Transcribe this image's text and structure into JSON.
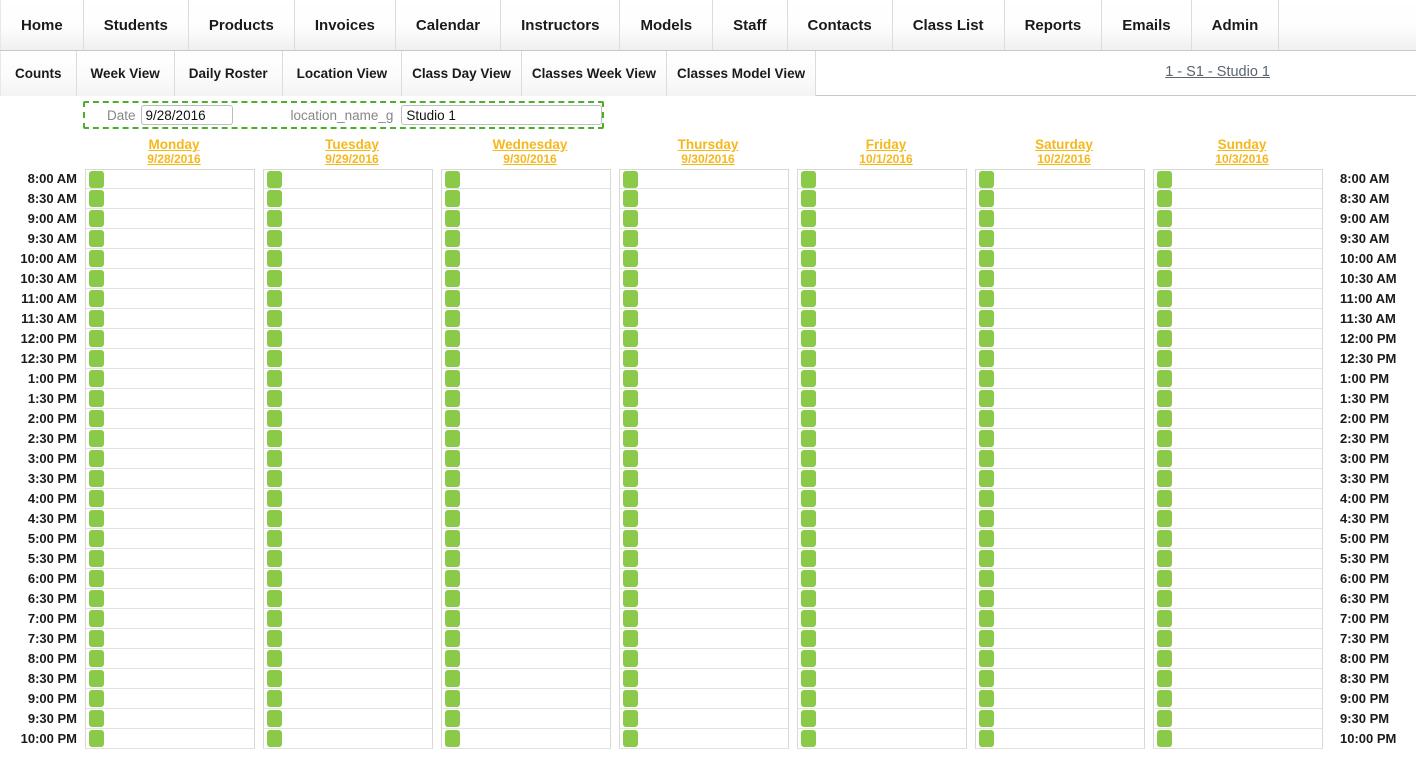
{
  "topnav": {
    "items": [
      {
        "label": "Home"
      },
      {
        "label": "Students"
      },
      {
        "label": "Products"
      },
      {
        "label": "Invoices"
      },
      {
        "label": "Calendar"
      },
      {
        "label": "Instructors"
      },
      {
        "label": "Models"
      },
      {
        "label": "Staff"
      },
      {
        "label": "Contacts"
      },
      {
        "label": "Class List"
      },
      {
        "label": "Reports"
      },
      {
        "label": "Emails"
      },
      {
        "label": "Admin"
      }
    ]
  },
  "subnav": {
    "items": [
      {
        "label": "Counts"
      },
      {
        "label": "Week View"
      },
      {
        "label": "Daily Roster"
      },
      {
        "label": "Location View"
      },
      {
        "label": "Class Day View"
      },
      {
        "label": "Classes Week View"
      },
      {
        "label": "Classes Model View"
      }
    ],
    "studio_link": "1 -  S1 - Studio 1"
  },
  "form": {
    "date_label": "Date",
    "date_value": "9/28/2016",
    "location_label": "location_name_g",
    "location_value": "Studio 1",
    "border_color": "#4caf2a"
  },
  "calendar": {
    "days": [
      {
        "name": "Monday",
        "date": "9/28/2016"
      },
      {
        "name": "Tuesday",
        "date": "9/29/2016"
      },
      {
        "name": "Wednesday",
        "date": "9/30/2016"
      },
      {
        "name": "Thursday",
        "date": "9/30/2016"
      },
      {
        "name": "Friday",
        "date": "10/1/2016"
      },
      {
        "name": "Saturday",
        "date": "10/2/2016"
      },
      {
        "name": "Sunday",
        "date": "10/3/2016"
      }
    ],
    "times": [
      "8:00 AM",
      "8:30 AM",
      "9:00 AM",
      "9:30 AM",
      "10:00 AM",
      "10:30 AM",
      "11:00 AM",
      "11:30 AM",
      "12:00 PM",
      "12:30 PM",
      "1:00 PM",
      "1:30 PM",
      "2:00 PM",
      "2:30 PM",
      "3:00 PM",
      "3:30 PM",
      "4:00 PM",
      "4:30 PM",
      "5:00 PM",
      "5:30 PM",
      "6:00 PM",
      "6:30 PM",
      "7:00 PM",
      "7:30 PM",
      "8:00 PM",
      "8:30 PM",
      "9:00 PM",
      "9:30 PM",
      "10:00 PM"
    ],
    "slot_color": "#8bc949",
    "day_header_color": "#f5b81c",
    "all_slots_available": true
  }
}
